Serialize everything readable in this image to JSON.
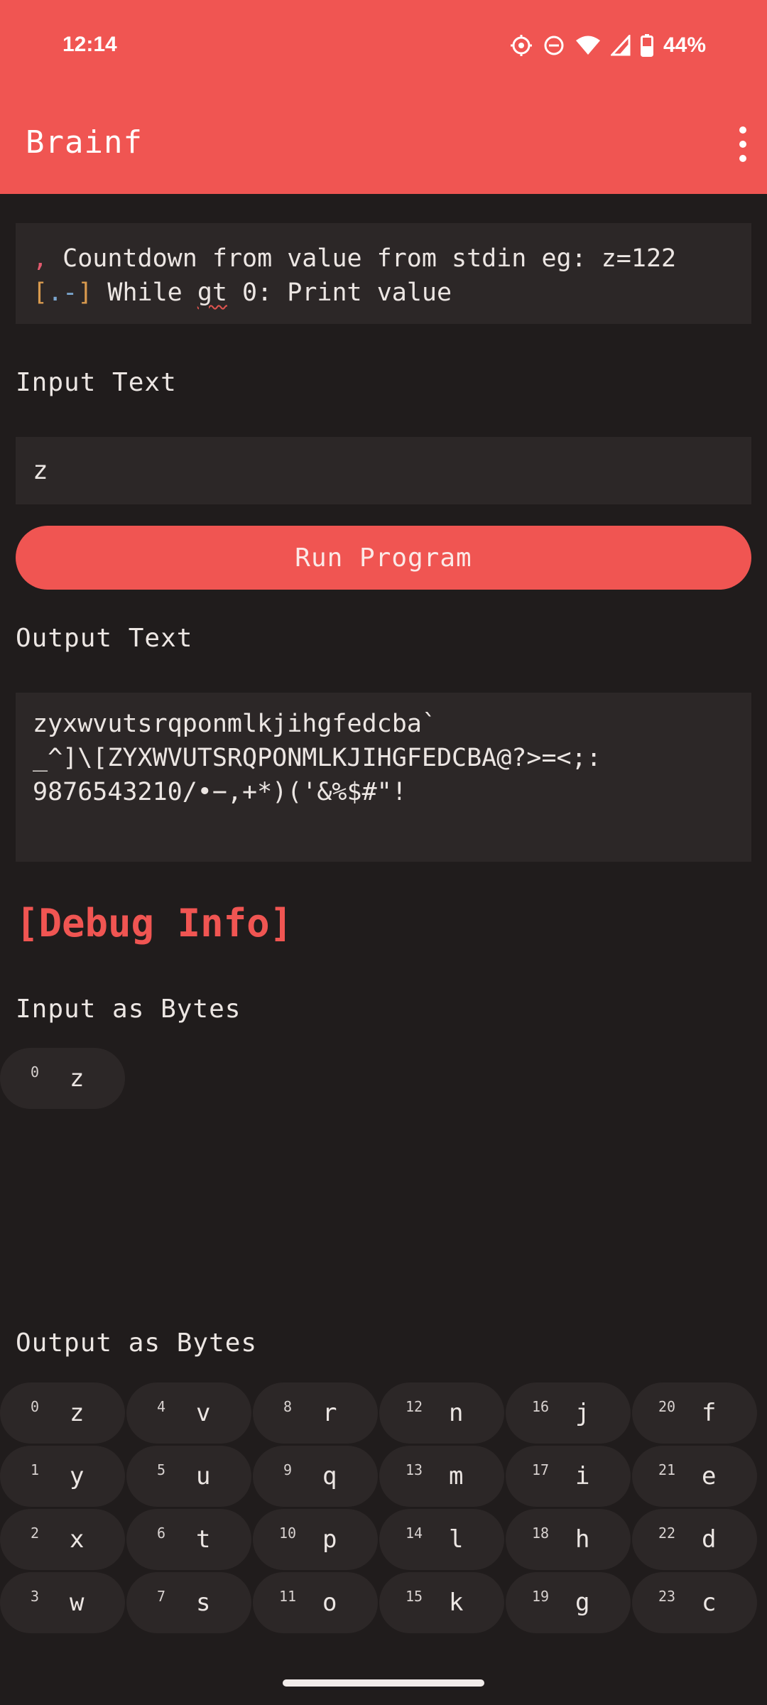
{
  "status": {
    "time": "12:14",
    "battery": "44%"
  },
  "app": {
    "title": "Brainf"
  },
  "code": {
    "line1_token": ",",
    "line1_text": " Countdown from value from stdin eg: z=122",
    "line2_open": "[",
    "line2_dot": ".",
    "line2_minus": "-",
    "line2_close": "]",
    "line2_pre": " While ",
    "line2_err": "gt",
    "line2_post": " 0: Print value"
  },
  "input": {
    "label": "Input Text",
    "value": "z"
  },
  "run_button": {
    "label": "Run Program"
  },
  "output": {
    "label": "Output Text",
    "lines": [
      "zyxwvutsrqponmlkjihgfedcba`",
      "_^]\\[ZYXWVUTSRQPONMLKJIHGFEDCBA@?>=<;:",
      "9876543210/•−,+*)('&%$#\"!"
    ]
  },
  "debug": {
    "title": "[Debug Info]",
    "input_bytes_label": "Input as Bytes",
    "input_bytes": [
      {
        "index": "0",
        "char": "z"
      }
    ],
    "output_bytes_label": "Output as Bytes",
    "output_bytes": [
      {
        "index": "0",
        "char": "z"
      },
      {
        "index": "1",
        "char": "y"
      },
      {
        "index": "2",
        "char": "x"
      },
      {
        "index": "3",
        "char": "w"
      },
      {
        "index": "4",
        "char": "v"
      },
      {
        "index": "5",
        "char": "u"
      },
      {
        "index": "6",
        "char": "t"
      },
      {
        "index": "7",
        "char": "s"
      },
      {
        "index": "8",
        "char": "r"
      },
      {
        "index": "9",
        "char": "q"
      },
      {
        "index": "10",
        "char": "p"
      },
      {
        "index": "11",
        "char": "o"
      },
      {
        "index": "12",
        "char": "n"
      },
      {
        "index": "13",
        "char": "m"
      },
      {
        "index": "14",
        "char": "l"
      },
      {
        "index": "15",
        "char": "k"
      },
      {
        "index": "16",
        "char": "j"
      },
      {
        "index": "17",
        "char": "i"
      },
      {
        "index": "18",
        "char": "h"
      },
      {
        "index": "19",
        "char": "g"
      },
      {
        "index": "20",
        "char": "f"
      },
      {
        "index": "21",
        "char": "e"
      },
      {
        "index": "22",
        "char": "d"
      },
      {
        "index": "23",
        "char": "c"
      }
    ]
  }
}
